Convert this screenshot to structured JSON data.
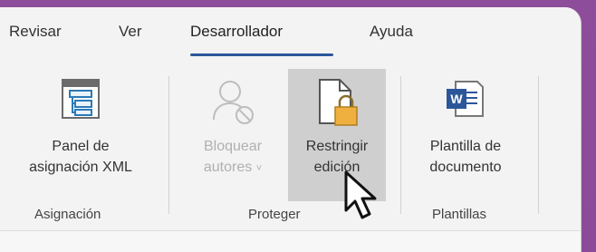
{
  "tabs": [
    {
      "label": "Revisar"
    },
    {
      "label": "Ver"
    },
    {
      "label": "Desarrollador",
      "active": true
    },
    {
      "label": "Ayuda"
    }
  ],
  "groups": {
    "asignacion": {
      "label": "Asignación",
      "buttons": [
        {
          "line1": "Panel de",
          "line2": "asignación XML",
          "icon": "xml-mapping-pane-icon"
        }
      ]
    },
    "proteger": {
      "label": "Proteger",
      "buttons": [
        {
          "line1": "Bloquear",
          "line2": "autores",
          "caret": "˅",
          "icon": "block-authors-icon",
          "disabled": true
        },
        {
          "line1": "Restringir",
          "line2": "edición",
          "icon": "restrict-editing-icon",
          "hovered": true
        }
      ]
    },
    "plantillas": {
      "label": "Plantillas",
      "buttons": [
        {
          "line1": "Plantilla de",
          "line2": "documento",
          "icon": "word-template-icon"
        }
      ]
    }
  },
  "colors": {
    "accent": "#2b579a",
    "background": "#f3f3f3",
    "hover": "#cfcfcf",
    "disabled_text": "#b0b0b0",
    "lock": "#f0b040"
  }
}
